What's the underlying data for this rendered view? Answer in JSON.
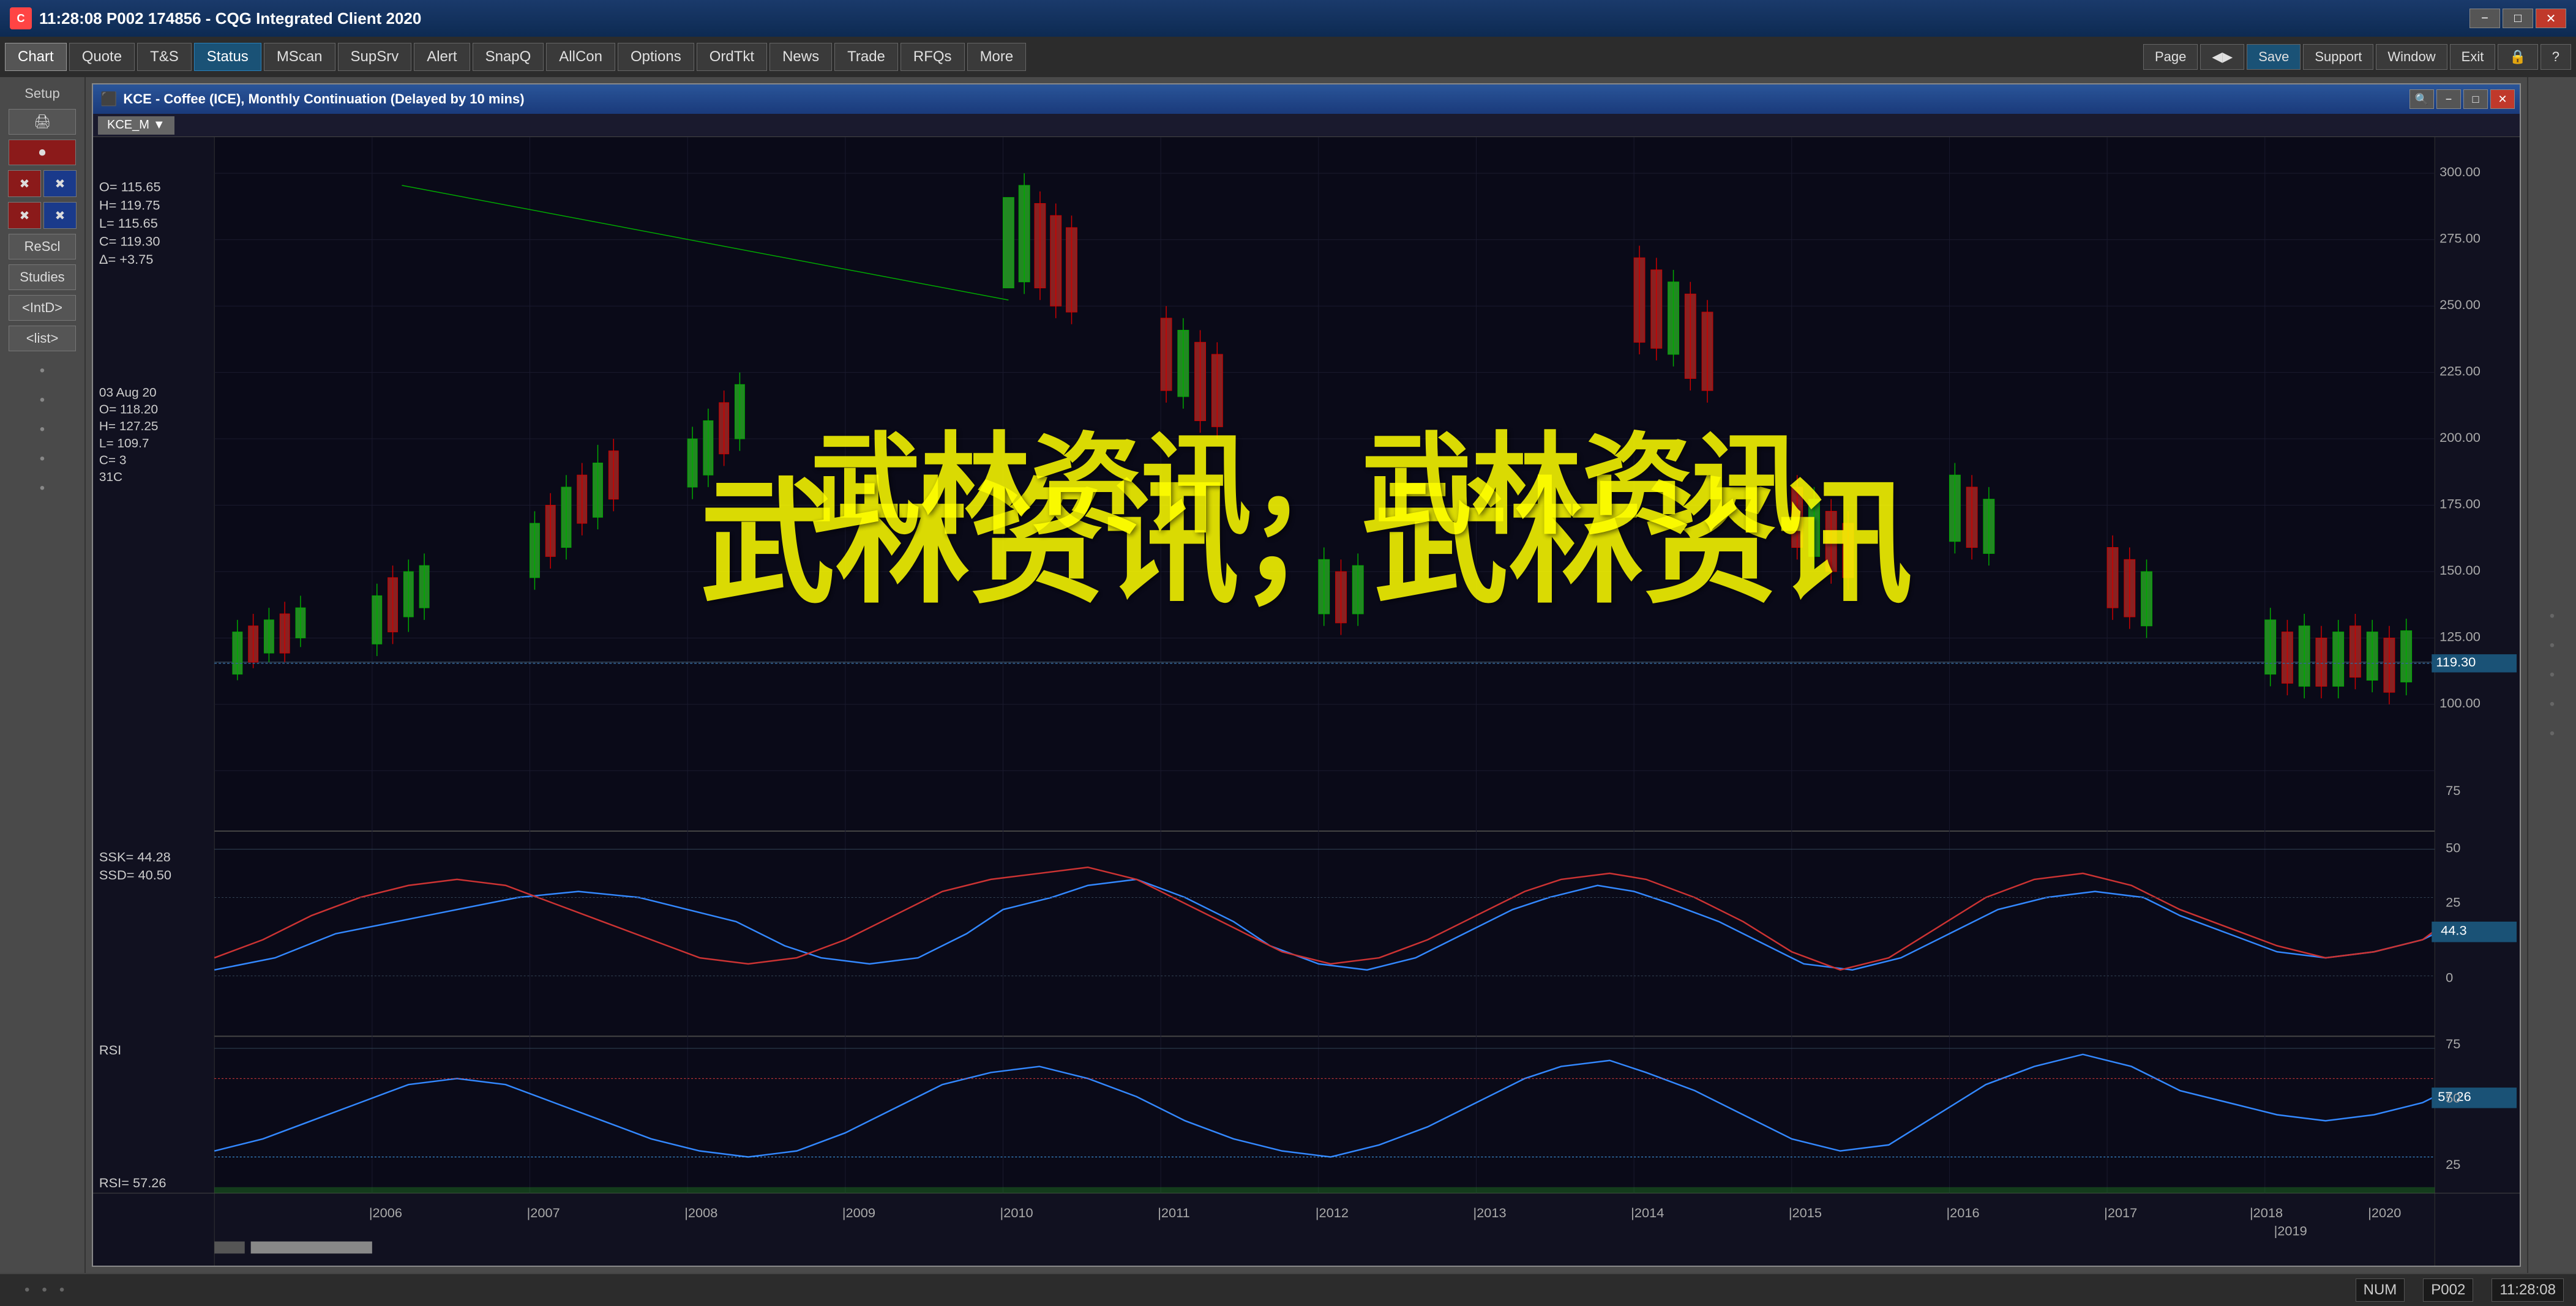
{
  "titlebar": {
    "icon": "C",
    "title": "11:28:08  P002  174856 - CQG Integrated Client 2020",
    "min": "−",
    "max": "□",
    "close": "✕"
  },
  "menubar": {
    "items": [
      {
        "label": "Chart",
        "active": true
      },
      {
        "label": "Quote",
        "active": false
      },
      {
        "label": "T&S",
        "active": false
      },
      {
        "label": "Status",
        "active": false
      },
      {
        "label": "MScan",
        "active": false
      },
      {
        "label": "SupSrv",
        "active": false
      },
      {
        "label": "Alert",
        "active": false
      },
      {
        "label": "SnapQ",
        "active": false
      },
      {
        "label": "AllCon",
        "active": false
      },
      {
        "label": "Options",
        "active": false
      },
      {
        "label": "OrdTkt",
        "active": false
      },
      {
        "label": "News",
        "active": false
      },
      {
        "label": "Trade",
        "active": false
      },
      {
        "label": "RFQs",
        "active": false
      },
      {
        "label": "More",
        "active": false
      }
    ],
    "right_items": [
      {
        "label": "Page"
      },
      {
        "label": "◀▶"
      },
      {
        "label": "Save"
      },
      {
        "label": "Support"
      },
      {
        "label": "Window"
      },
      {
        "label": "Exit"
      },
      {
        "label": "🔒"
      },
      {
        "label": "?"
      }
    ]
  },
  "sidebar": {
    "setup_label": "Setup",
    "print_icon": "🖨",
    "rec_icon": "⏺",
    "buttons": [
      {
        "type": "row",
        "left": "red-cross",
        "right": "red-cross"
      },
      {
        "type": "row",
        "left": "red-cross",
        "right": "red-cross"
      }
    ],
    "rescl_label": "ReScl",
    "studies_label": "Studies",
    "intd_label": "<IntD>",
    "list_label": "<list>"
  },
  "chart_window": {
    "title": "KCE - Coffee (ICE), Monthly Continuation (Delayed by 10 mins)",
    "tab": "KCE_M",
    "tab_icon": "▼",
    "info": {
      "open": "O= 115.65",
      "high": "H= 119.75",
      "low": "L= 115.65",
      "close": "C= 119.30",
      "delta": "Δ= +3.75"
    },
    "tooltip": {
      "date": "03 Aug 20",
      "open": "O= 118.20",
      "high": "H= 127.25",
      "low": "L= 109.7",
      "close": "C= 3",
      "delta": "31C"
    },
    "price_levels": [
      {
        "value": "300.00",
        "pct": 2
      },
      {
        "value": "275.00",
        "pct": 10
      },
      {
        "value": "250.00",
        "pct": 18
      },
      {
        "value": "225.00",
        "pct": 26
      },
      {
        "value": "200.00",
        "pct": 34
      },
      {
        "value": "175.00",
        "pct": 42
      },
      {
        "value": "150.00",
        "pct": 50
      },
      {
        "value": "125.00",
        "pct": 58
      },
      {
        "value": "119.30",
        "pct": 61,
        "active": true
      },
      {
        "value": "100.00",
        "pct": 66
      },
      {
        "value": "75",
        "pct": 72
      },
      {
        "value": "50",
        "pct": 78
      },
      {
        "value": "44.3",
        "pct": 81,
        "active": true
      },
      {
        "value": "25",
        "pct": 84
      },
      {
        "value": "0",
        "pct": 88
      },
      {
        "value": "75",
        "pct": 91
      },
      {
        "value": "57.26",
        "pct": 94,
        "active": true
      },
      {
        "value": "50",
        "pct": 96
      },
      {
        "value": "25",
        "pct": 98
      }
    ],
    "time_labels": [
      "2006",
      "2007",
      "2008",
      "2009",
      "2010",
      "2011",
      "2012",
      "2013",
      "2014",
      "2015",
      "2016",
      "2017",
      "2018",
      "2019",
      "2020"
    ],
    "stochastic": {
      "ssk_label": "SSK=",
      "ssk_value": "44.28",
      "ssd_label": "SSD=",
      "ssd_value": "40.50"
    },
    "rsi": {
      "label": "RSI",
      "value_label": "RSI=",
      "value": "57.26"
    }
  },
  "watermark": {
    "text": "武林资讯，武林资讯"
  },
  "statusbar": {
    "num": "NUM",
    "account": "P002",
    "time": "11:28:08"
  }
}
